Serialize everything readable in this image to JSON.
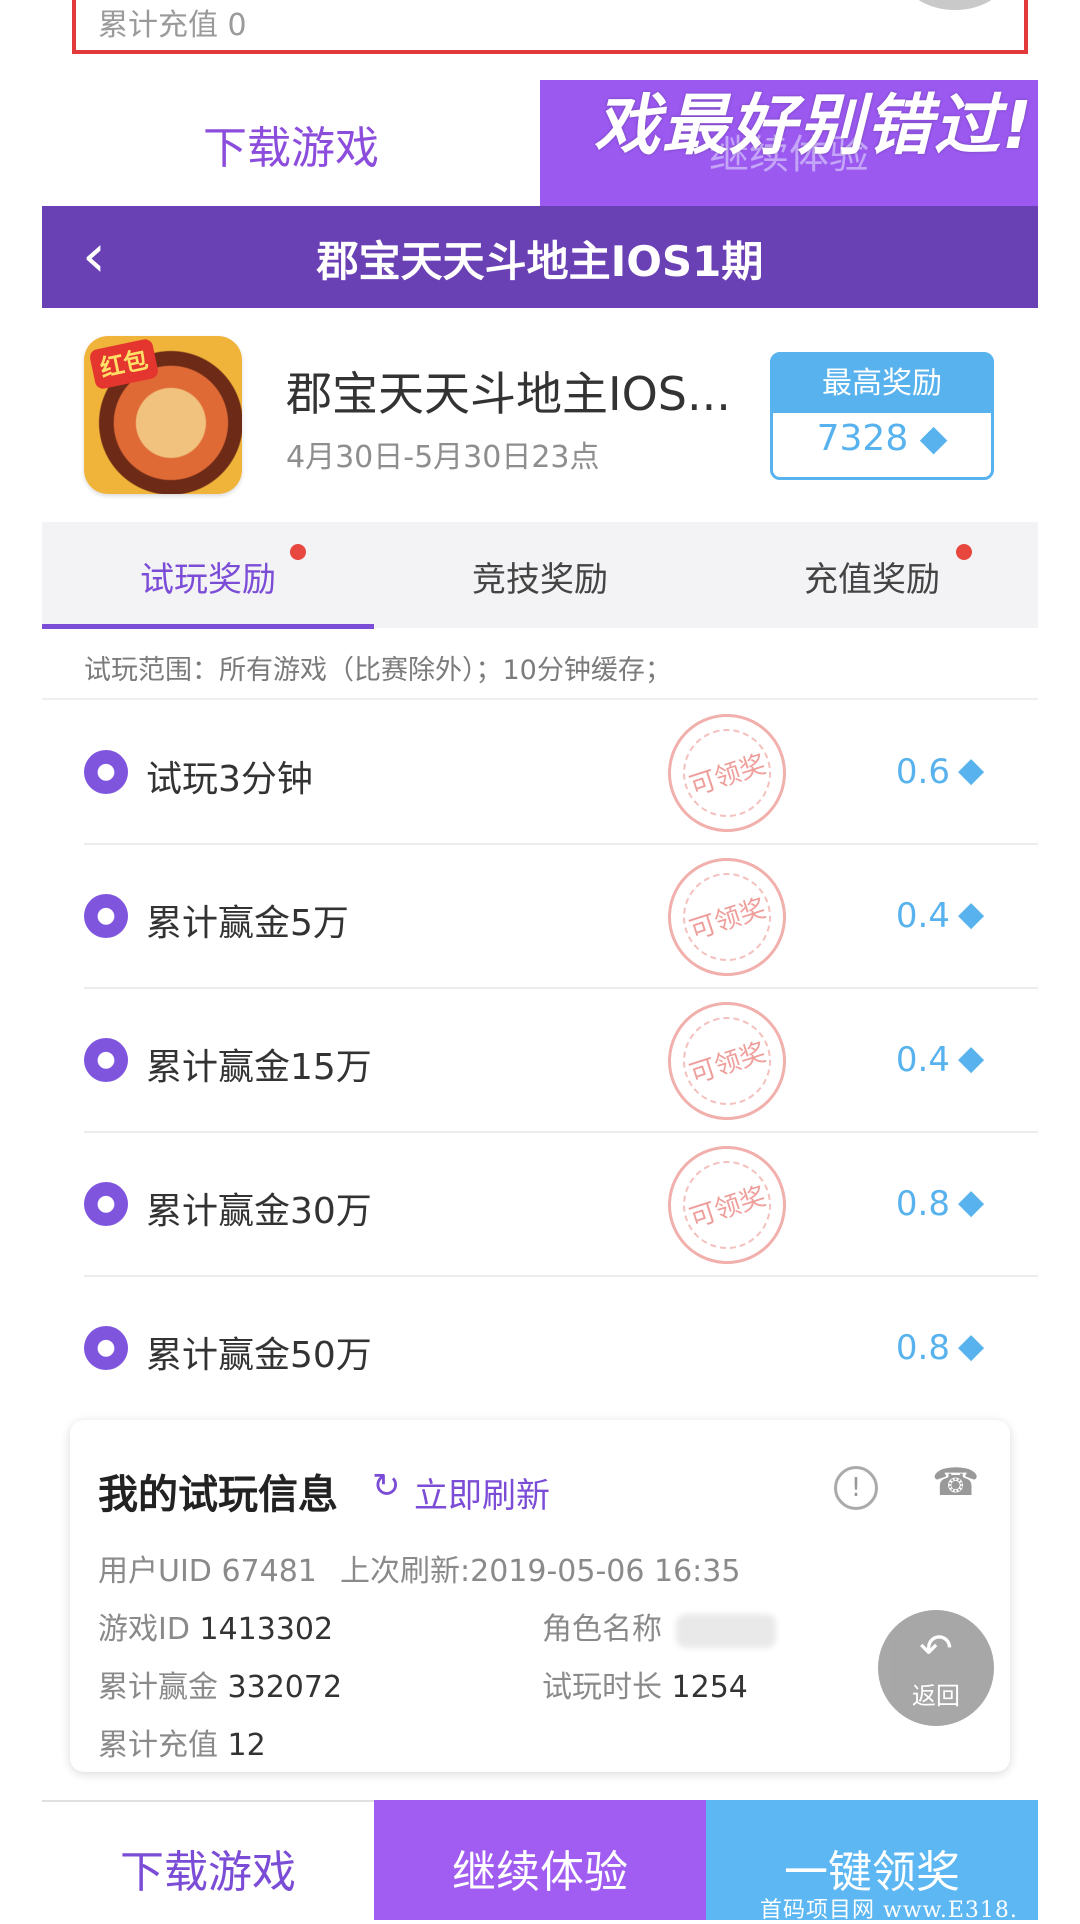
{
  "top": {
    "partial_label": "累计充值 0"
  },
  "overlay": {
    "tab_download": "下载游戏",
    "tab_continue": "继续体验",
    "banner_text": "戏最好别错过!"
  },
  "header": {
    "back_icon": "chevron-left-icon",
    "title": "郡宝天天斗地主IOS1期"
  },
  "game": {
    "name": "郡宝天天斗地主IOS...",
    "date_range": "4月30日-5月30日23点",
    "icon_tag": "红包",
    "max_reward_label": "最高奖励",
    "max_reward_value": "7328"
  },
  "tabs": [
    {
      "label": "试玩奖励",
      "active": true,
      "dot": true
    },
    {
      "label": "竞技奖励",
      "active": false,
      "dot": false
    },
    {
      "label": "充值奖励",
      "active": false,
      "dot": true
    }
  ],
  "scope_text": "试玩范围：所有游戏（比赛除外）；10分钟缓存；",
  "tasks": [
    {
      "label": "试玩3分钟",
      "stamp": "可领奖",
      "value": "0.6"
    },
    {
      "label": "累计赢金5万",
      "stamp": "可领奖",
      "value": "0.4"
    },
    {
      "label": "累计赢金15万",
      "stamp": "可领奖",
      "value": "0.4"
    },
    {
      "label": "累计赢金30万",
      "stamp": "可领奖",
      "value": "0.8"
    },
    {
      "label": "累计赢金50万",
      "stamp": "",
      "value": "0.8"
    }
  ],
  "info": {
    "title": "我的试玩信息",
    "refresh_label": "立即刷新",
    "uid_label": "用户UID",
    "uid_value": "67481",
    "last_refresh_label": "上次刷新:",
    "last_refresh_value": "2019-05-06 16:35",
    "game_id_label": "游戏ID",
    "game_id_value": "1413302",
    "role_name_label": "角色名称",
    "win_total_label": "累计赢金",
    "win_total_value": "332072",
    "play_time_label": "试玩时长",
    "play_time_value": "1254",
    "recharge_label": "累计充值",
    "recharge_value": "12"
  },
  "return_button": {
    "label": "返回"
  },
  "bottom": {
    "download": "下载游戏",
    "continue": "继续体验",
    "claim": "一键领奖"
  },
  "watermark": "首码项目网 www.E318.",
  "colors": {
    "purple": "#6a40b5",
    "accent_purple": "#7b4cd6",
    "blue": "#58b2ee",
    "red_dot": "#e8473f"
  }
}
